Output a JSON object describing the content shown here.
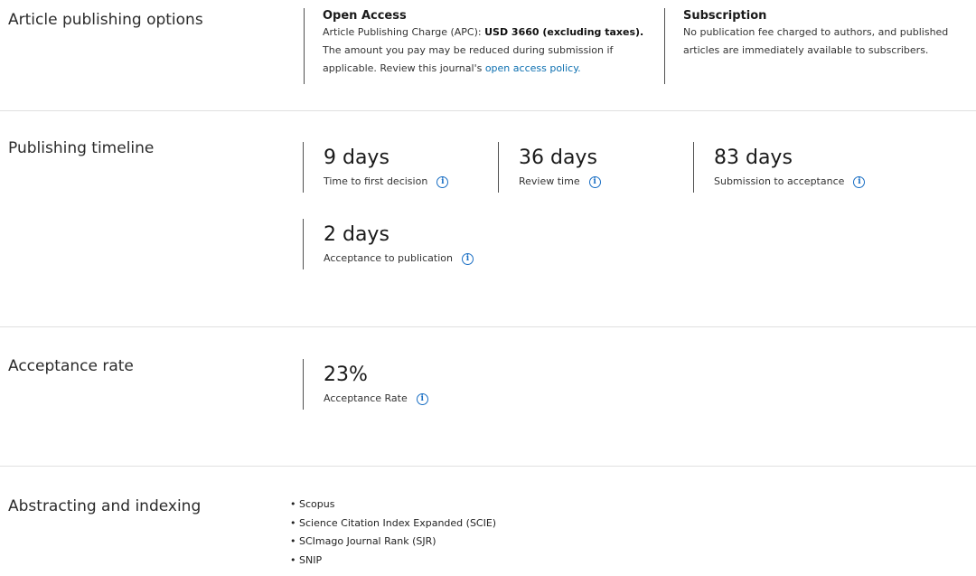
{
  "sections": {
    "publishing_options": "Article publishing options",
    "timeline": "Publishing timeline",
    "acceptance": "Acceptance rate",
    "indexing": "Abstracting and indexing"
  },
  "options": {
    "open_access": {
      "title": "Open Access",
      "apc_prefix": "Article Publishing Charge (APC): ",
      "apc_value": "USD 3660 (excluding taxes).",
      "text": "The amount you pay may be reduced during submission if applicable. Review this journal's ",
      "link": "open access policy."
    },
    "subscription": {
      "title": "Subscription",
      "text": "No publication fee charged to authors, and published articles are immediately available to subscribers."
    }
  },
  "timeline": [
    {
      "value": "9 days",
      "label": "Time to first decision"
    },
    {
      "value": "36 days",
      "label": "Review time"
    },
    {
      "value": "83 days",
      "label": "Submission to acceptance"
    },
    {
      "value": "2 days",
      "label": "Acceptance to publication"
    }
  ],
  "acceptance": {
    "value": "23%",
    "label": "Acceptance Rate"
  },
  "indexing": [
    "Scopus",
    "Science Citation Index Expanded (SCIE)",
    "SCImago Journal Rank (SJR)",
    "SNIP"
  ],
  "icons": {
    "info": "info-circle-icon"
  },
  "colors": {
    "link": "#0c6fb0",
    "info_icon": "#1a6fc4"
  }
}
